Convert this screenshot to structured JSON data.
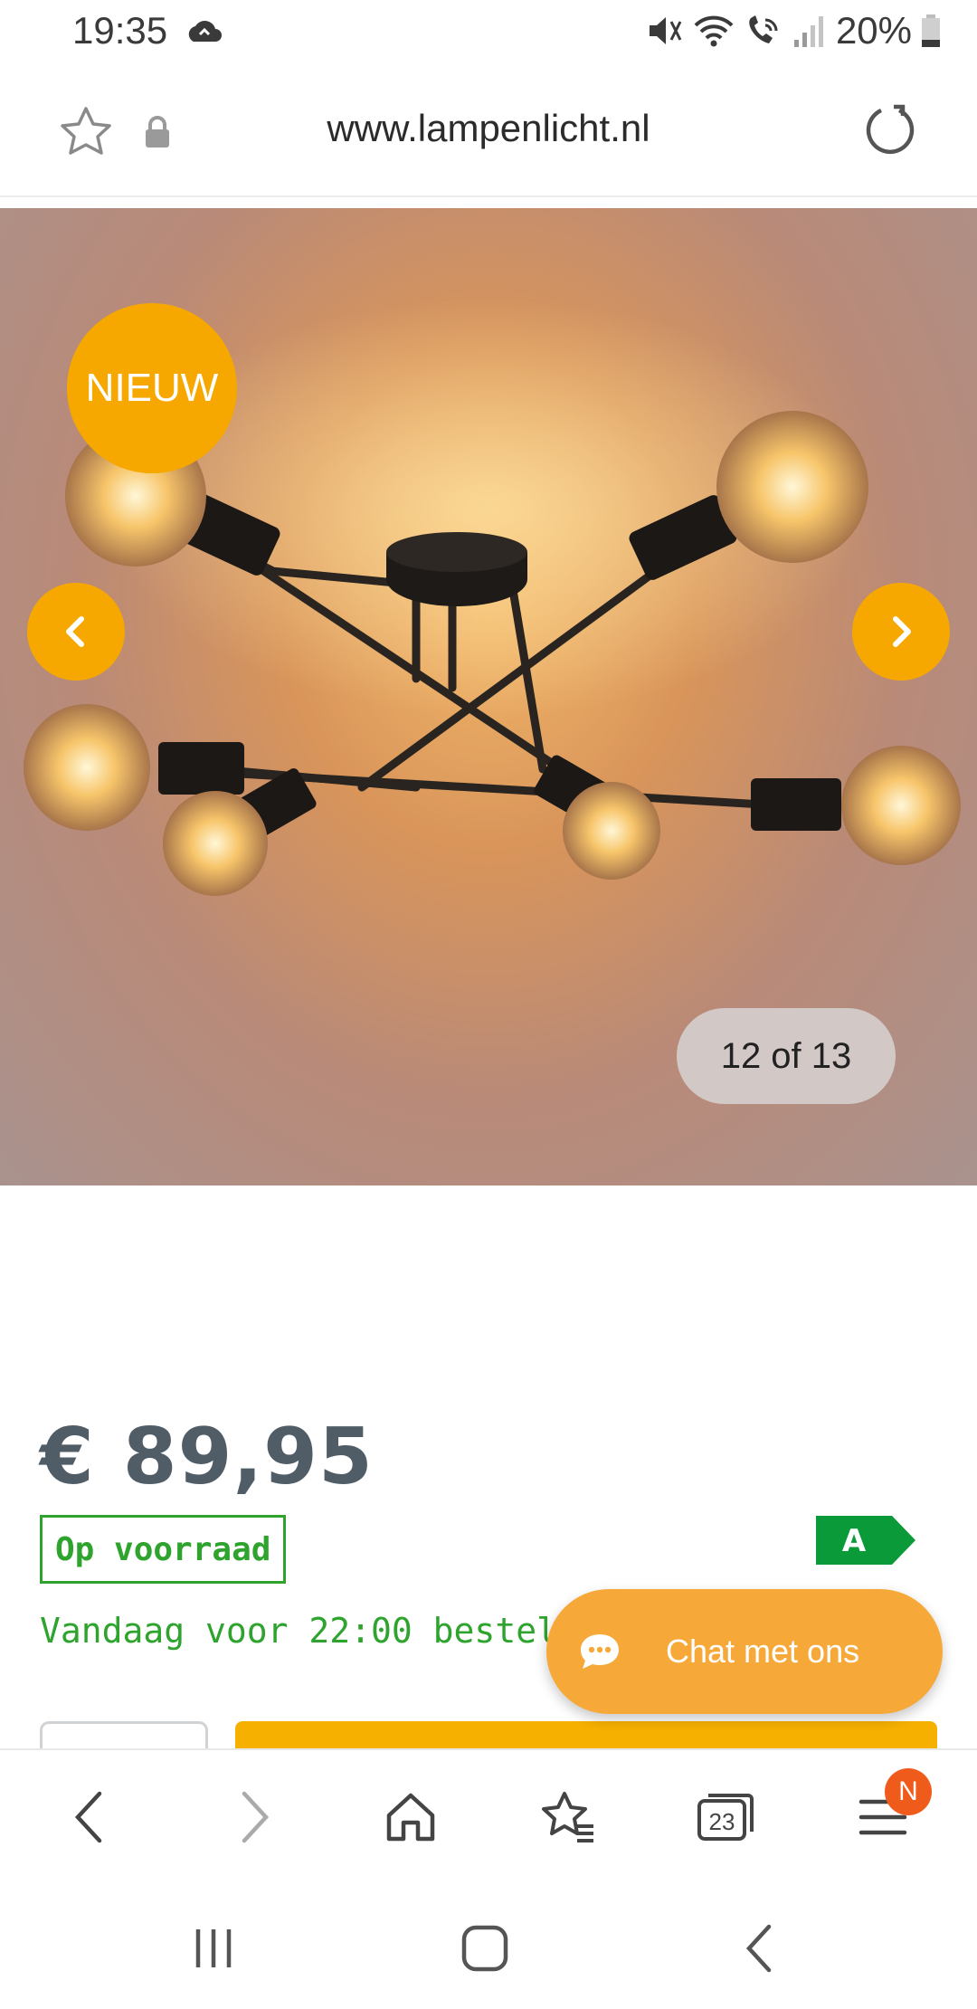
{
  "status_bar": {
    "time": "19:35",
    "battery": "20%"
  },
  "address_bar": {
    "url": "www.lampenlicht.nl"
  },
  "gallery": {
    "badge": "NIEUW",
    "counter": "12 of 13"
  },
  "product": {
    "price": "€ 89,95",
    "stock": "Op voorraad",
    "energy_label": "A",
    "delivery": "Vandaag voor 22:00 besteld, m"
  },
  "chat": {
    "label": "Chat met ons"
  },
  "bottom_bar": {
    "tabs_count": "23",
    "menu_badge": "N"
  },
  "colors": {
    "accent": "#f6a800",
    "stock_green": "#2ea32e",
    "energy_green": "#0a9a3a",
    "price": "#505c66"
  }
}
